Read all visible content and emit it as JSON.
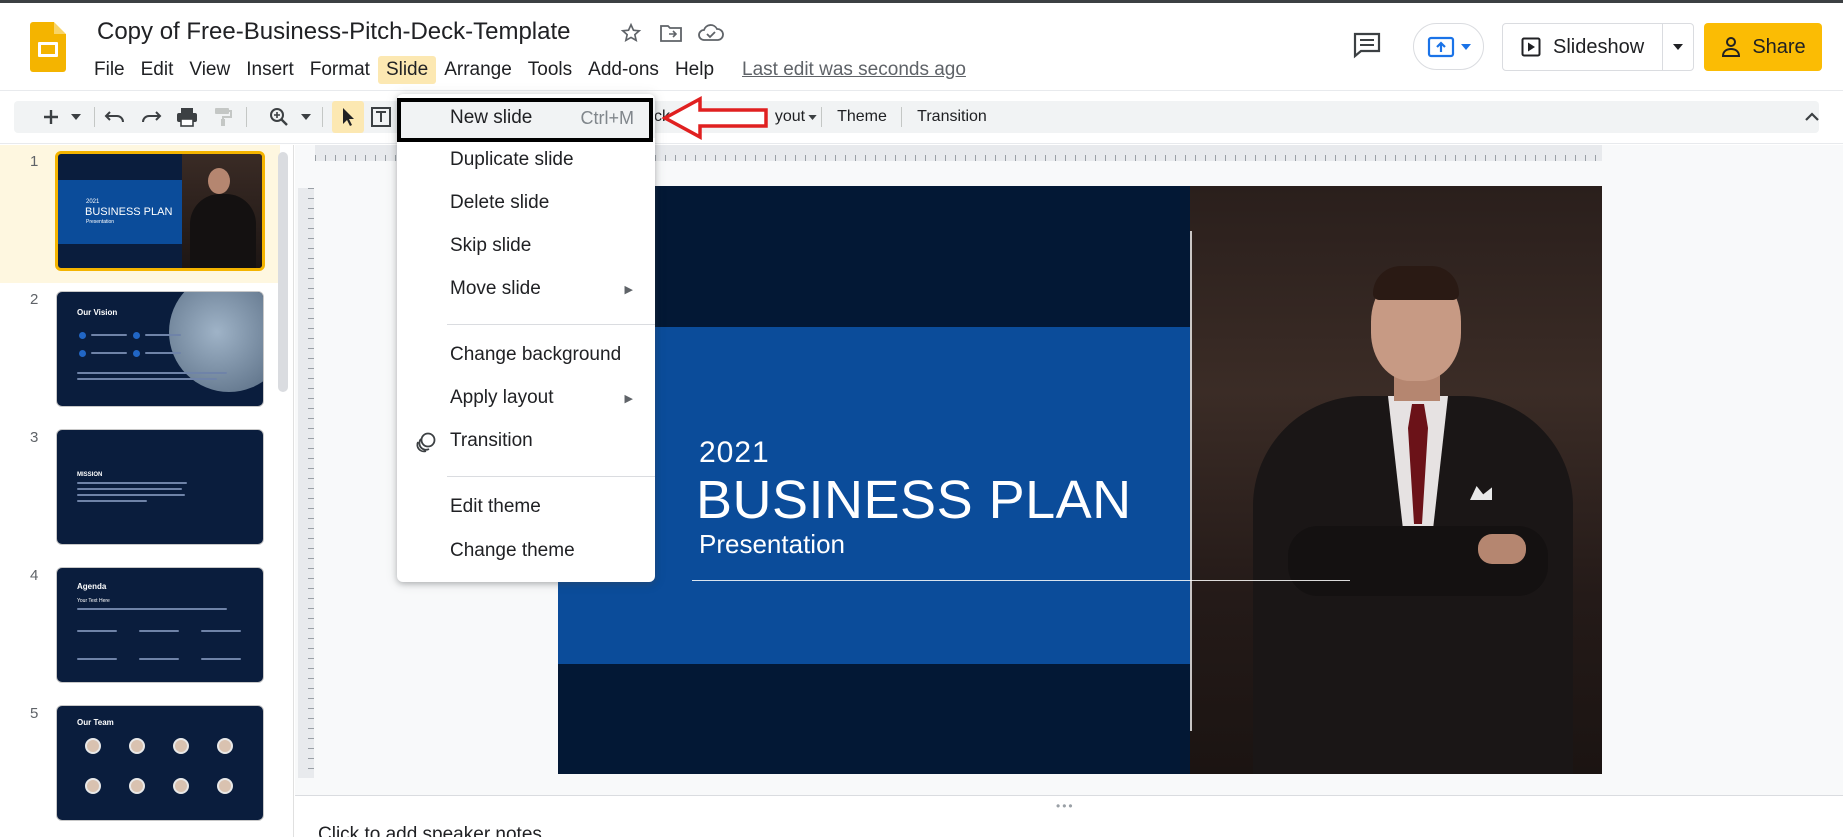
{
  "header": {
    "doc_title": "Copy of Free-Business-Pitch-Deck-Template",
    "last_edit": "Last edit was seconds ago",
    "slideshow_label": "Slideshow",
    "share_label": "Share"
  },
  "menubar": {
    "items": [
      "File",
      "Edit",
      "View",
      "Insert",
      "Format",
      "Slide",
      "Arrange",
      "Tools",
      "Add-ons",
      "Help"
    ]
  },
  "toolbar": {
    "background_partial": "ck",
    "layout_partial": "yout",
    "theme_label": "Theme",
    "transition_label": "Transition"
  },
  "slide_menu": {
    "items": [
      {
        "label": "New slide",
        "shortcut": "Ctrl+M"
      },
      {
        "label": "Duplicate slide"
      },
      {
        "label": "Delete slide"
      },
      {
        "label": "Skip slide"
      },
      {
        "label": "Move slide",
        "submenu": true
      },
      {
        "label": "Change background"
      },
      {
        "label": "Apply layout",
        "submenu": true
      },
      {
        "label": "Transition",
        "icon": "transition-icon"
      },
      {
        "label": "Edit theme"
      },
      {
        "label": "Change theme"
      }
    ]
  },
  "filmstrip": {
    "slides": [
      {
        "number": "1",
        "title": "BUSINESS PLAN",
        "year": "2021",
        "sub": "Presentation"
      },
      {
        "number": "2",
        "title": "Our Vision"
      },
      {
        "number": "3",
        "title": "MISSION"
      },
      {
        "number": "4",
        "title": "Agenda",
        "sub": "Your Text Here"
      },
      {
        "number": "5",
        "title": "Our Team"
      }
    ]
  },
  "slide": {
    "year": "2021",
    "title": "BUSINESS PLAN",
    "subtitle": "Presentation"
  },
  "notes": {
    "placeholder": "Click to add speaker notes"
  },
  "colors": {
    "slide_background": "#031835",
    "slide_blue": "#0b4c9a",
    "share_yellow": "#fbbc04",
    "highlight": "#000000",
    "annotation_arrow": "#e02020"
  }
}
